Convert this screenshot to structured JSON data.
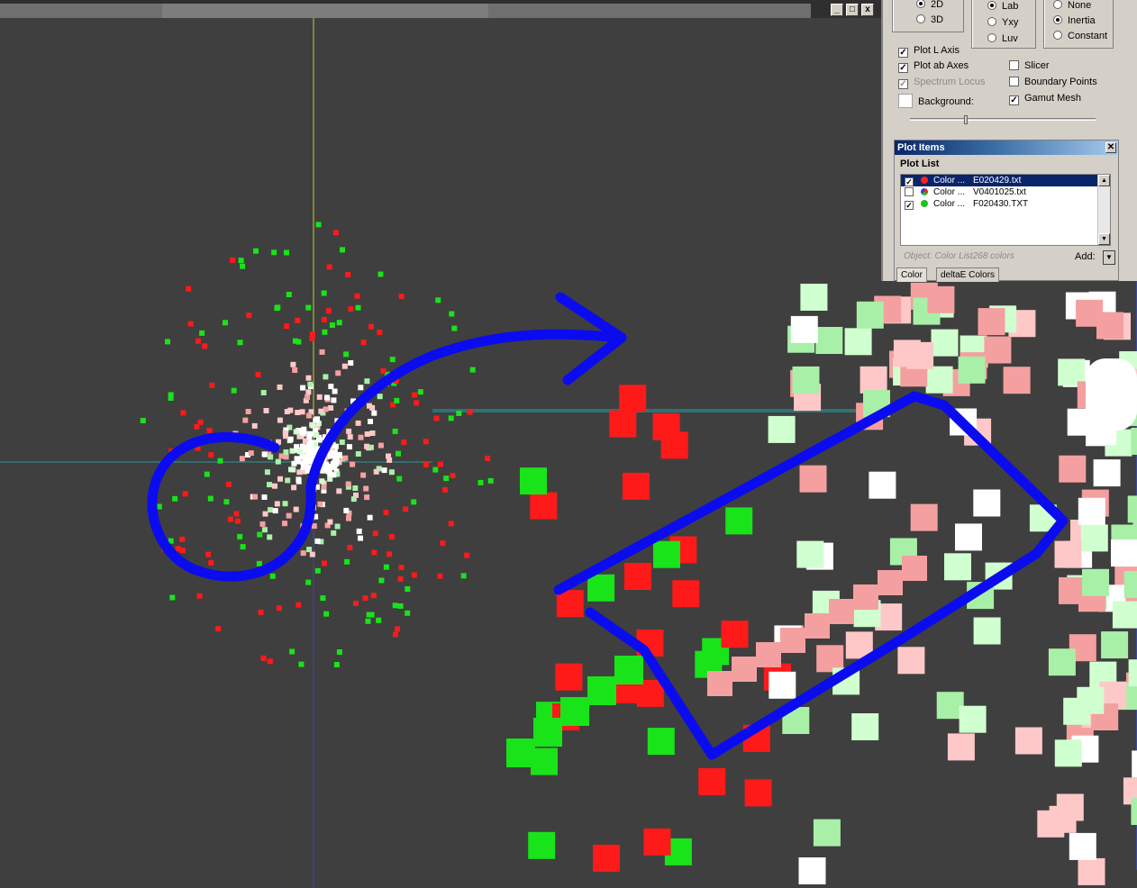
{
  "panel": {
    "dimension": [
      {
        "label": "2D",
        "selected": true
      },
      {
        "label": "3D",
        "selected": false
      }
    ],
    "colorspace": [
      {
        "label": "Lab",
        "selected": true
      },
      {
        "label": "Yxy",
        "selected": false
      },
      {
        "label": "Luv",
        "selected": false
      }
    ],
    "rotation": [
      {
        "label": "None",
        "selected": false
      },
      {
        "label": "Inertia",
        "selected": true
      },
      {
        "label": "Constant",
        "selected": false
      }
    ],
    "plot_l_axis": {
      "label": "Plot L Axis",
      "checked": true
    },
    "plot_ab_axes": {
      "label": "Plot ab Axes",
      "checked": true
    },
    "spectrum_locus": {
      "label": "Spectrum Locus",
      "checked": true,
      "disabled": true
    },
    "background": {
      "label": "Background:"
    },
    "slicer": {
      "label": "Slicer",
      "checked": false
    },
    "boundary_points": {
      "label": "Boundary Points",
      "checked": false
    },
    "gamut_mesh": {
      "label": "Gamut Mesh",
      "checked": true
    }
  },
  "plot_items": {
    "title": "Plot Items",
    "list_label": "Plot List",
    "rows": [
      {
        "name": "Color ...",
        "file": "E020429.txt",
        "checked": true,
        "selected": true,
        "dot": "#ff2020"
      },
      {
        "name": "Color ...",
        "file": "V0401025.txt",
        "checked": false,
        "selected": false,
        "dot": "multi"
      },
      {
        "name": "Color ...",
        "file": "F020430.TXT",
        "checked": true,
        "selected": false,
        "dot": "#20c020"
      }
    ],
    "object_text": "Object: Color List268 colors",
    "add_label": "Add:",
    "tabs": [
      "Color",
      "deltaE Colors"
    ]
  },
  "window_buttons": [
    "_",
    "□",
    "x"
  ],
  "colors": {
    "background": "#3f3f3f",
    "red": "#ff1a1a",
    "green": "#19e319",
    "pink": "#f4a0a0",
    "light_green": "#a8f0a8",
    "annotation": "#0c0cff",
    "l_axis": "#d2d23c",
    "ab_axis": "#2aa0a0"
  }
}
